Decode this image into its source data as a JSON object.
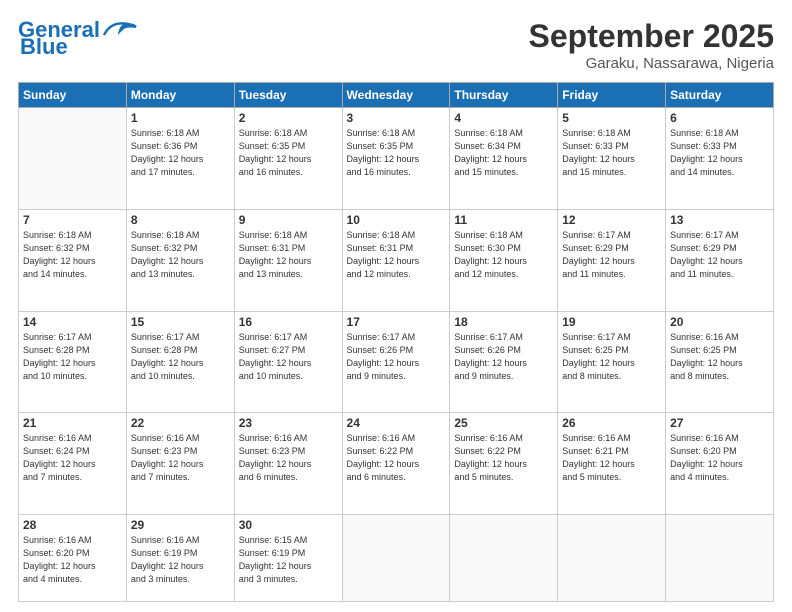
{
  "logo": {
    "line1": "General",
    "line2": "Blue"
  },
  "title": "September 2025",
  "location": "Garaku, Nassarawa, Nigeria",
  "weekdays": [
    "Sunday",
    "Monday",
    "Tuesday",
    "Wednesday",
    "Thursday",
    "Friday",
    "Saturday"
  ],
  "weeks": [
    [
      {
        "day": "",
        "info": ""
      },
      {
        "day": "1",
        "info": "Sunrise: 6:18 AM\nSunset: 6:36 PM\nDaylight: 12 hours\nand 17 minutes."
      },
      {
        "day": "2",
        "info": "Sunrise: 6:18 AM\nSunset: 6:35 PM\nDaylight: 12 hours\nand 16 minutes."
      },
      {
        "day": "3",
        "info": "Sunrise: 6:18 AM\nSunset: 6:35 PM\nDaylight: 12 hours\nand 16 minutes."
      },
      {
        "day": "4",
        "info": "Sunrise: 6:18 AM\nSunset: 6:34 PM\nDaylight: 12 hours\nand 15 minutes."
      },
      {
        "day": "5",
        "info": "Sunrise: 6:18 AM\nSunset: 6:33 PM\nDaylight: 12 hours\nand 15 minutes."
      },
      {
        "day": "6",
        "info": "Sunrise: 6:18 AM\nSunset: 6:33 PM\nDaylight: 12 hours\nand 14 minutes."
      }
    ],
    [
      {
        "day": "7",
        "info": "Sunrise: 6:18 AM\nSunset: 6:32 PM\nDaylight: 12 hours\nand 14 minutes."
      },
      {
        "day": "8",
        "info": "Sunrise: 6:18 AM\nSunset: 6:32 PM\nDaylight: 12 hours\nand 13 minutes."
      },
      {
        "day": "9",
        "info": "Sunrise: 6:18 AM\nSunset: 6:31 PM\nDaylight: 12 hours\nand 13 minutes."
      },
      {
        "day": "10",
        "info": "Sunrise: 6:18 AM\nSunset: 6:31 PM\nDaylight: 12 hours\nand 12 minutes."
      },
      {
        "day": "11",
        "info": "Sunrise: 6:18 AM\nSunset: 6:30 PM\nDaylight: 12 hours\nand 12 minutes."
      },
      {
        "day": "12",
        "info": "Sunrise: 6:17 AM\nSunset: 6:29 PM\nDaylight: 12 hours\nand 11 minutes."
      },
      {
        "day": "13",
        "info": "Sunrise: 6:17 AM\nSunset: 6:29 PM\nDaylight: 12 hours\nand 11 minutes."
      }
    ],
    [
      {
        "day": "14",
        "info": "Sunrise: 6:17 AM\nSunset: 6:28 PM\nDaylight: 12 hours\nand 10 minutes."
      },
      {
        "day": "15",
        "info": "Sunrise: 6:17 AM\nSunset: 6:28 PM\nDaylight: 12 hours\nand 10 minutes."
      },
      {
        "day": "16",
        "info": "Sunrise: 6:17 AM\nSunset: 6:27 PM\nDaylight: 12 hours\nand 10 minutes."
      },
      {
        "day": "17",
        "info": "Sunrise: 6:17 AM\nSunset: 6:26 PM\nDaylight: 12 hours\nand 9 minutes."
      },
      {
        "day": "18",
        "info": "Sunrise: 6:17 AM\nSunset: 6:26 PM\nDaylight: 12 hours\nand 9 minutes."
      },
      {
        "day": "19",
        "info": "Sunrise: 6:17 AM\nSunset: 6:25 PM\nDaylight: 12 hours\nand 8 minutes."
      },
      {
        "day": "20",
        "info": "Sunrise: 6:16 AM\nSunset: 6:25 PM\nDaylight: 12 hours\nand 8 minutes."
      }
    ],
    [
      {
        "day": "21",
        "info": "Sunrise: 6:16 AM\nSunset: 6:24 PM\nDaylight: 12 hours\nand 7 minutes."
      },
      {
        "day": "22",
        "info": "Sunrise: 6:16 AM\nSunset: 6:23 PM\nDaylight: 12 hours\nand 7 minutes."
      },
      {
        "day": "23",
        "info": "Sunrise: 6:16 AM\nSunset: 6:23 PM\nDaylight: 12 hours\nand 6 minutes."
      },
      {
        "day": "24",
        "info": "Sunrise: 6:16 AM\nSunset: 6:22 PM\nDaylight: 12 hours\nand 6 minutes."
      },
      {
        "day": "25",
        "info": "Sunrise: 6:16 AM\nSunset: 6:22 PM\nDaylight: 12 hours\nand 5 minutes."
      },
      {
        "day": "26",
        "info": "Sunrise: 6:16 AM\nSunset: 6:21 PM\nDaylight: 12 hours\nand 5 minutes."
      },
      {
        "day": "27",
        "info": "Sunrise: 6:16 AM\nSunset: 6:20 PM\nDaylight: 12 hours\nand 4 minutes."
      }
    ],
    [
      {
        "day": "28",
        "info": "Sunrise: 6:16 AM\nSunset: 6:20 PM\nDaylight: 12 hours\nand 4 minutes."
      },
      {
        "day": "29",
        "info": "Sunrise: 6:16 AM\nSunset: 6:19 PM\nDaylight: 12 hours\nand 3 minutes."
      },
      {
        "day": "30",
        "info": "Sunrise: 6:15 AM\nSunset: 6:19 PM\nDaylight: 12 hours\nand 3 minutes."
      },
      {
        "day": "",
        "info": ""
      },
      {
        "day": "",
        "info": ""
      },
      {
        "day": "",
        "info": ""
      },
      {
        "day": "",
        "info": ""
      }
    ]
  ]
}
